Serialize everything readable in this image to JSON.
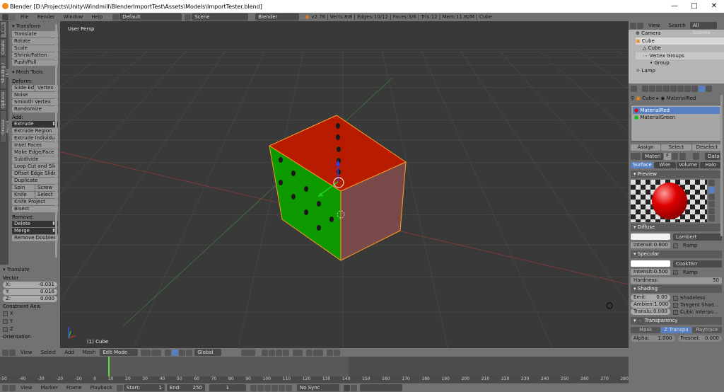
{
  "window": {
    "title": "Blender [D:\\Projects\\Unity\\Windmill\\BlenderImportTest\\Assets\\Models\\ImportTester.blend]",
    "minimize": "—",
    "maximize": "□",
    "close": "✕"
  },
  "menubar": {
    "items": [
      "File",
      "Render",
      "Window",
      "Help"
    ],
    "layout": "Default",
    "scene": "Scene",
    "engine": "Blender Render",
    "stats": "v2.76 | Verts:8/8 | Edges:10/12 | Faces:3/6 | Tris:12 | Mem:11.82M | Cube"
  },
  "tools": {
    "tabs": [
      "Tools",
      "Create",
      "Shading / UVs",
      "Options",
      "Grease Pencil"
    ],
    "transform_header": "Transform",
    "transform": [
      "Translate",
      "Rotate",
      "Scale",
      "Shrink/Fatten",
      "Push/Pull"
    ],
    "mesh_header": "Mesh Tools",
    "deform_label": "Deform:",
    "slide_edge": "Slide Ed",
    "vertex": "Vertex",
    "noise": "Noise",
    "smooth_vertex": "Smooth Vertex",
    "randomize": "Randomize",
    "add_label": "Add:",
    "extrude": "Extrude",
    "add_items": [
      "Extrude Region",
      "Extrude Individual",
      "Inset Faces",
      "Make Edge/Face",
      "Subdivide",
      "Loop Cut and Slide",
      "Offset Edge Slide",
      "Duplicate"
    ],
    "spin": "Spin",
    "screw": "Screw",
    "knife": "Knife",
    "select": "Select",
    "knife_project": "Knife Project",
    "bisect": "Bisect",
    "remove_label": "Remove:",
    "delete": "Delete",
    "merge": "Merge",
    "remove_doubles": "Remove Doubles"
  },
  "operator": {
    "header": "Translate",
    "vector_label": "Vector",
    "x_label": "X:",
    "x": "-0.031",
    "y_label": "Y:",
    "y": "0.016",
    "z_label": "Z:",
    "z": "0.000",
    "constraint_label": "Constraint Axis",
    "cx": "X",
    "cy": "Y",
    "cz": "Z",
    "orientation": "Orientation"
  },
  "viewport": {
    "persp": "User Persp",
    "object": "(1) Cube"
  },
  "v3dheader": {
    "view": "View",
    "select": "Select",
    "add": "Add",
    "mesh": "Mesh",
    "mode": "Edit Mode",
    "orientation": "Global"
  },
  "outliner": {
    "view": "View",
    "search": "Search",
    "all_scenes": "All Scenes",
    "items": [
      "Camera",
      "Cube",
      "Cube",
      "Vertex Groups",
      "Group",
      "Lamp"
    ]
  },
  "properties": {
    "breadcrumb_obj": "Cube",
    "breadcrumb_mat": "MaterialRed",
    "materials": [
      "MaterialRed",
      "MaterialGreen"
    ],
    "assign": "Assign",
    "select": "Select",
    "deselect": "Deselect",
    "mat_name": "Materi",
    "f": "F",
    "data": "Data",
    "tabs": [
      "Surface",
      "Wire",
      "Volume",
      "Halo"
    ],
    "preview_header": "Preview",
    "diffuse_header": "Diffuse",
    "diffuse_shader": "Lambert",
    "intensity_label": "Intensit:",
    "diff_intensity": "0.800",
    "ramp": "Ramp",
    "specular_header": "Specular",
    "spec_shader": "CookTorr",
    "spec_intensity": "0.500",
    "hardness_label": "Hardness:",
    "hardness": "50",
    "shading_header": "Shading",
    "emit_label": "Emit:",
    "emit": "0.00",
    "ambient_label": "Ambien:",
    "ambient": "1.000",
    "translu_label": "Translu:",
    "translu": "0.000",
    "shadeless": "Shadeless",
    "tangent": "Tangent Shad...",
    "cubic": "Cubic Interpo...",
    "transparency_header": "Transparency",
    "mask": "Mask",
    "ztransp": "Z Transpa",
    "raytrace": "Raytrace",
    "alpha_label": "Alpha:",
    "alpha": "1.000",
    "fresnel_label": "Fresnel:",
    "fresnel": "0.000"
  },
  "timeline": {
    "ticks": [
      "-50",
      "-40",
      "-30",
      "-20",
      "-10",
      "0",
      "10",
      "20",
      "30",
      "40",
      "50",
      "60",
      "70",
      "80",
      "90",
      "100",
      "110",
      "120",
      "130",
      "140",
      "150",
      "160",
      "170",
      "180",
      "190",
      "200",
      "210",
      "220",
      "230",
      "240",
      "250",
      "260",
      "270",
      "280"
    ],
    "view": "View",
    "marker": "Marker",
    "frame": "Frame",
    "playback": "Playback",
    "start_label": "Start:",
    "start": "1",
    "end_label": "End:",
    "end": "250",
    "current": "1",
    "sync": "No Sync"
  },
  "colors": {
    "accent": "#5680c2",
    "red_face": "#b81c00",
    "green_face": "#0c9a00",
    "selected_edge": "#ff9e24"
  }
}
